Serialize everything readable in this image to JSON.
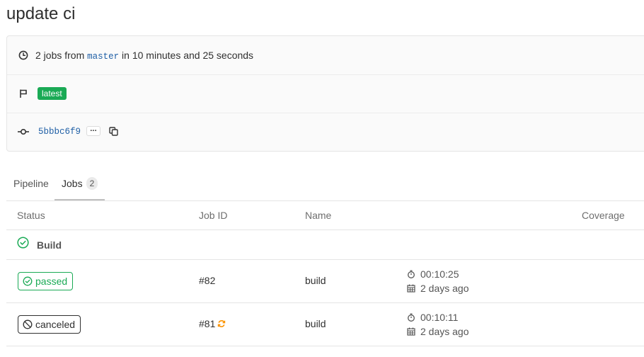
{
  "page": {
    "title": "update ci"
  },
  "pipeline_info": {
    "jobs_prefix": "2 jobs from",
    "branch": "master",
    "duration_text": "in 10 minutes and 25 seconds",
    "badge": "latest",
    "commit_sha": "5bbbc6f9"
  },
  "tabs": [
    {
      "label": "Pipeline"
    },
    {
      "label": "Jobs",
      "count": "2"
    }
  ],
  "table": {
    "headers": {
      "status": "Status",
      "job_id": "Job ID",
      "name": "Name",
      "coverage": "Coverage"
    },
    "stage": {
      "name": "Build"
    },
    "jobs": [
      {
        "status": "passed",
        "status_color": "#1aaa55",
        "id": "#82",
        "name": "build",
        "duration": "00:10:25",
        "finished": "2 days ago",
        "retried": false
      },
      {
        "status": "canceled",
        "status_color": "#303030",
        "id": "#81",
        "name": "build",
        "duration": "00:10:11",
        "finished": "2 days ago",
        "retried": true
      }
    ]
  },
  "colors": {
    "success": "#1aaa55",
    "link": "#1f5fa6",
    "retry": "#fc9403"
  },
  "icons": [
    "clock-icon",
    "flag-icon",
    "commit-icon",
    "ellipsis-icon",
    "copy-icon",
    "status-success-icon",
    "status-canceled-icon",
    "retry-icon",
    "timer-icon",
    "calendar-icon"
  ]
}
